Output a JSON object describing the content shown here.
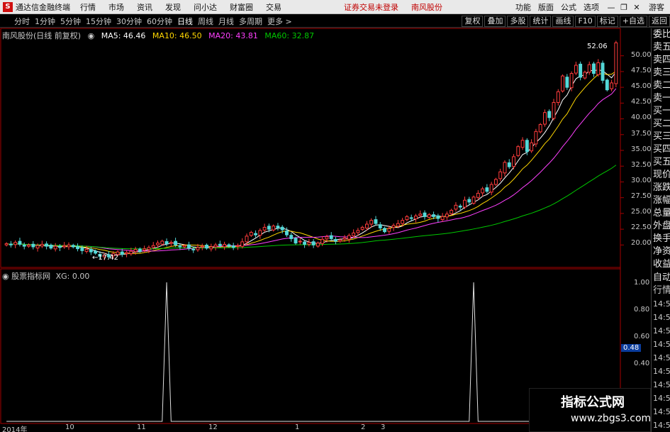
{
  "menubar": {
    "app_title": "通达信金融终端",
    "items": [
      "行情",
      "市场",
      "资讯",
      "发现",
      "问小达",
      "财富圈",
      "交易"
    ],
    "warning": "证券交易未登录",
    "stock_name": "南风股份",
    "right_items": [
      "功能",
      "版面",
      "公式",
      "选项"
    ],
    "guest": "游客"
  },
  "toolbar": {
    "periods": [
      "分时",
      "1分钟",
      "5分钟",
      "15分钟",
      "30分钟",
      "60分钟",
      "日线",
      "周线",
      "月线",
      "多周期",
      "更多 >"
    ],
    "active": "日线",
    "right_buttons": [
      "复权",
      "叠加",
      "多股",
      "统计",
      "画线",
      "F10",
      "标记",
      "+自选",
      "返回"
    ]
  },
  "kline_info": {
    "title": "南风股份(日线 前复权)",
    "ma5": "MA5: 46.46",
    "ma10": "MA10: 46.50",
    "ma20": "MA20: 43.81",
    "ma60": "MA60: 32.87"
  },
  "price_axis": [
    "50.00",
    "47.50",
    "45.00",
    "42.50",
    "40.00",
    "37.50",
    "35.00",
    "32.50",
    "30.00",
    "27.50",
    "25.00",
    "22.50",
    "20.00"
  ],
  "high_label": "52.06",
  "low_label": "17.42",
  "sub_info": {
    "title": "股票指标网",
    "xg": "XG: 0.00"
  },
  "sub_axis": [
    "1.00",
    "0.80",
    "0.60",
    "0.48",
    "0.40"
  ],
  "x_axis": [
    "2014年",
    "10",
    "11",
    "12",
    "1",
    "2",
    "3"
  ],
  "right_panel": [
    "委比",
    "卖五",
    "卖四",
    "卖三",
    "卖二",
    "卖一",
    "买一",
    "买二",
    "买三",
    "买四",
    "买五",
    "现价",
    "涨跌",
    "涨幅",
    "总量",
    "外盘",
    "换手",
    "净资",
    "收益",
    "自动",
    "行情",
    "14:50",
    "14:50",
    "14:50",
    "14:50",
    "14:50",
    "14:50",
    "14:50",
    "14:50",
    "14:50",
    "14:50",
    "14:50"
  ],
  "watermark": {
    "line1": "指标公式网",
    "line2": "www.zbgs3.com"
  },
  "colors": {
    "up": "#ff3c3c",
    "down": "#54d8d8",
    "ma5": "#ffffff",
    "ma10": "#ffd700",
    "ma20": "#ff40ff",
    "ma60": "#00c800",
    "border": "#a40000"
  },
  "chart_data": {
    "type": "candlestick",
    "ylim": [
      17.0,
      53.0
    ],
    "closes": [
      20.2,
      20.0,
      20.4,
      20.1,
      19.8,
      20.0,
      19.7,
      19.9,
      20.1,
      19.8,
      19.5,
      19.8,
      19.6,
      19.9,
      20.0,
      19.7,
      19.4,
      19.1,
      19.3,
      18.9,
      18.7,
      18.2,
      18.4,
      18.1,
      18.6,
      18.9,
      18.5,
      18.8,
      19.0,
      19.3,
      19.0,
      19.4,
      19.6,
      19.9,
      20.3,
      20.6,
      20.2,
      20.4,
      20.0,
      19.7,
      19.9,
      19.5,
      19.3,
      19.6,
      19.8,
      19.5,
      19.7,
      20.0,
      19.9,
      20.1,
      19.8,
      19.6,
      19.9,
      20.5,
      21.4,
      22.0,
      21.6,
      22.3,
      22.8,
      22.5,
      23.0,
      22.7,
      22.4,
      21.6,
      21.0,
      20.3,
      20.6,
      20.1,
      20.4,
      20.0,
      20.3,
      20.9,
      21.3,
      21.0,
      20.6,
      20.8,
      21.1,
      21.5,
      21.9,
      22.3,
      22.8,
      23.3,
      23.9,
      23.4,
      22.7,
      22.1,
      22.6,
      23.1,
      23.4,
      23.9,
      24.5,
      24.2,
      24.6,
      24.9,
      24.5,
      24.8,
      24.5,
      24.2,
      24.5,
      24.9,
      25.5,
      26.3,
      26.0,
      27.1,
      26.8,
      27.6,
      28.2,
      28.9,
      28.5,
      29.6,
      30.4,
      31.6,
      33.1,
      32.4,
      34.0,
      35.6,
      36.6,
      34.8,
      36.2,
      38.0,
      39.1,
      41.0,
      40.2,
      42.6,
      44.3,
      46.8,
      45.0,
      47.2,
      48.5,
      46.6,
      47.4,
      48.6,
      47.2,
      48.9,
      46.1,
      44.6,
      45.7,
      52.06
    ],
    "spike_x_index": [
      36,
      105
    ],
    "spike_value": 1.0,
    "sub_ylim": [
      0,
      1.0
    ]
  }
}
